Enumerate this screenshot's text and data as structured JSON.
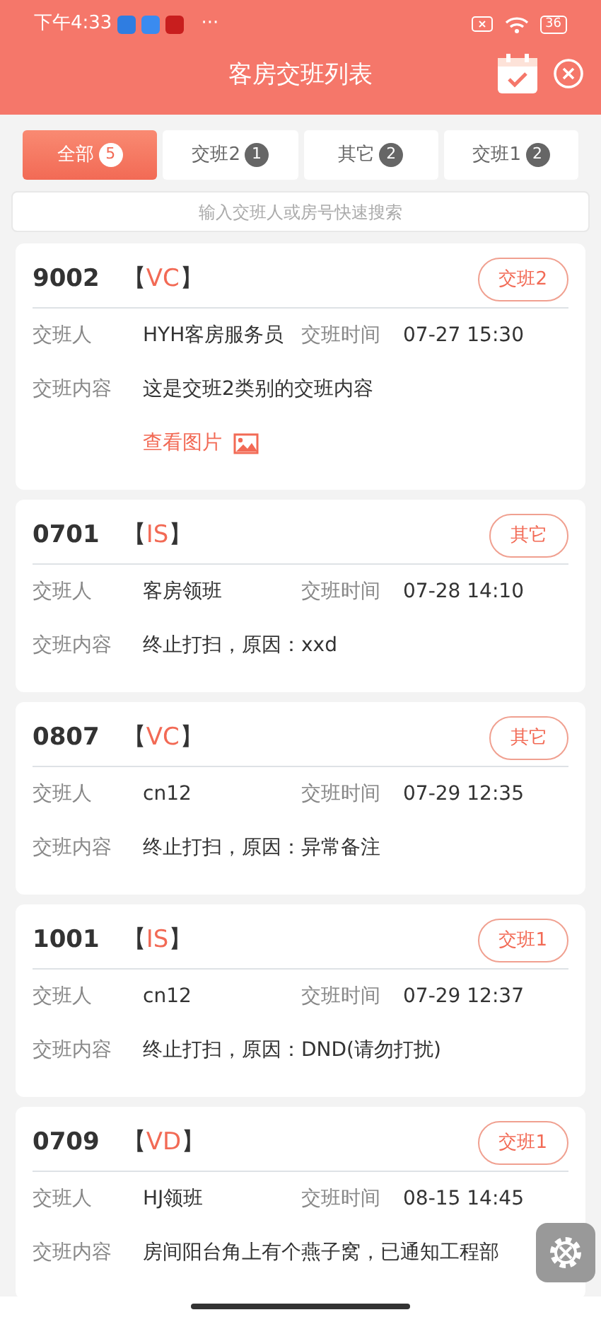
{
  "status_bar": {
    "time": "下午4:33",
    "more": "···",
    "battery": "36"
  },
  "header": {
    "title": "客房交班列表"
  },
  "tabs": [
    {
      "label": "全部",
      "count": "5",
      "selected": true
    },
    {
      "label": "交班2",
      "count": "1",
      "selected": false
    },
    {
      "label": "其它",
      "count": "2",
      "selected": false
    },
    {
      "label": "交班1",
      "count": "2",
      "selected": false
    }
  ],
  "search": {
    "placeholder": "输入交班人或房号快速搜索"
  },
  "records": [
    {
      "room": "9002",
      "status_open": "【",
      "status": "VC",
      "status_close": "】",
      "tag": "交班2",
      "person_label": "交班人",
      "person": "HYH客房服务员",
      "time_label": "交班时间",
      "time": "07-27 15:30",
      "content_label": "交班内容",
      "content": "这是交班2类别的交班内容",
      "image_link": "查看图片"
    },
    {
      "room": "0701",
      "status_open": "【",
      "status": "IS",
      "status_close": "】",
      "tag": "其它",
      "person_label": "交班人",
      "person": "客房领班",
      "time_label": "交班时间",
      "time": "07-28 14:10",
      "content_label": "交班内容",
      "content": "终止打扫，原因：xxd"
    },
    {
      "room": "0807",
      "status_open": "【",
      "status": "VC",
      "status_close": "】",
      "tag": "其它",
      "person_label": "交班人",
      "person": "cn12",
      "time_label": "交班时间",
      "time": "07-29 12:35",
      "content_label": "交班内容",
      "content": "终止打扫，原因：异常备注"
    },
    {
      "room": "1001",
      "status_open": "【",
      "status": "IS",
      "status_close": "】",
      "tag": "交班1",
      "person_label": "交班人",
      "person": "cn12",
      "time_label": "交班时间",
      "time": "07-29 12:37",
      "content_label": "交班内容",
      "content": "终止打扫，原因：DND(请勿打扰)"
    },
    {
      "room": "0709",
      "status_open": "【",
      "status": "VD",
      "status_close": "】",
      "tag": "交班1",
      "person_label": "交班人",
      "person": "HJ领班",
      "time_label": "交班时间",
      "time": "08-15 14:45",
      "content_label": "交班内容",
      "content": "房间阳台角上有个燕子窝，已通知工程部"
    }
  ]
}
